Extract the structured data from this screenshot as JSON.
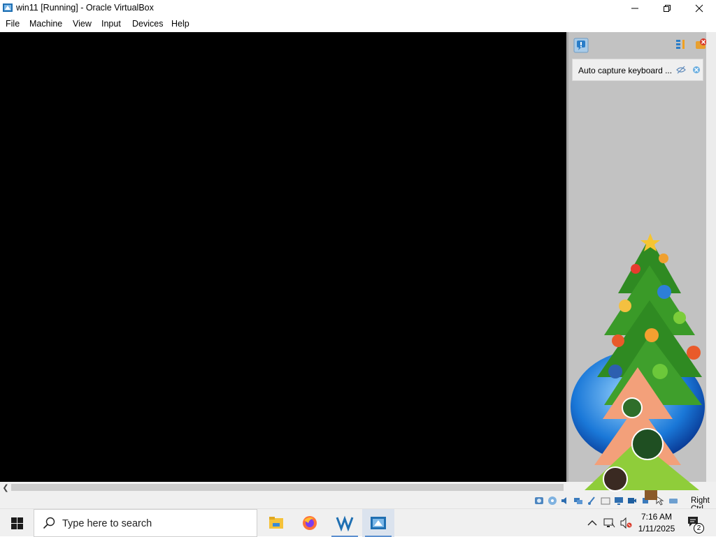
{
  "window": {
    "title": "win11 [Running] - Oracle VirtualBox",
    "controls": {
      "minimize": "minimize-icon",
      "restore": "restore-icon",
      "close": "close-icon"
    }
  },
  "menu": {
    "items": [
      {
        "label": "File"
      },
      {
        "label": "Machine"
      },
      {
        "label": "View"
      },
      {
        "label": "Input"
      },
      {
        "label": "Devices"
      },
      {
        "label": "Help"
      }
    ]
  },
  "notification_center": {
    "notice": {
      "text": "Auto capture keyboard ...",
      "hide_icon": "eye-off-icon",
      "close_icon": "close-icon"
    }
  },
  "statusbar": {
    "host_key": "Right Ctrl",
    "icons": [
      "hard-disk-icon",
      "optical-disk-icon",
      "audio-icon",
      "network-icon",
      "usb-icon",
      "shared-folder-icon",
      "display-icon",
      "recording-icon",
      "cpu-icon",
      "mouse-integration-icon",
      "keyboard-icon"
    ]
  },
  "taskbar": {
    "search_placeholder": "Type here to search",
    "apps": [
      "file-explorer-icon",
      "firefox-icon",
      "visual-studio-icon",
      "virtualbox-icon"
    ],
    "clock": {
      "time": "7:16 AM",
      "date": "1/11/2025"
    },
    "notification_count": "2",
    "colors": {
      "accent": "#5b8fd0",
      "firefox_orange": "#ff7139",
      "vbox_blue": "#1f6fb2"
    }
  }
}
